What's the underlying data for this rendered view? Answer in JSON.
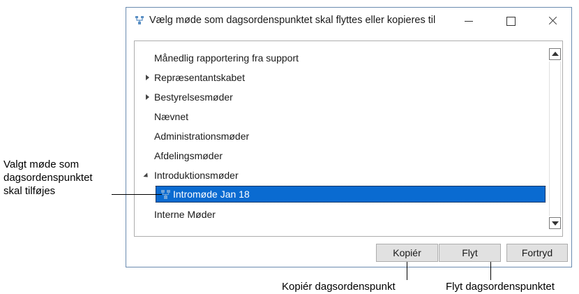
{
  "window": {
    "title": "Vælg møde som dagsordenspunktet skal flyttes eller kopieres til",
    "icon": "meeting-tree-icon"
  },
  "tree": {
    "items": [
      {
        "label": "Månedlig rapportering fra support",
        "expander": "none"
      },
      {
        "label": "Repræsentantskabet",
        "expander": "collapsed"
      },
      {
        "label": "Bestyrelsesmøder",
        "expander": "collapsed"
      },
      {
        "label": "Nævnet",
        "expander": "none"
      },
      {
        "label": "Administrationsmøder",
        "expander": "none"
      },
      {
        "label": "Afdelingsmøder",
        "expander": "none"
      },
      {
        "label": "Introduktionsmøder",
        "expander": "expanded"
      },
      {
        "label": "Interne Møder",
        "expander": "none"
      }
    ],
    "selected": {
      "label": "Intromøde Jan 18",
      "icon": "meeting-icon"
    },
    "selection_color": "#0a6bd1"
  },
  "buttons": {
    "copy": "Kopiér",
    "move": "Flyt",
    "cancel": "Fortryd"
  },
  "annotations": {
    "selected_meeting": [
      "Valgt møde som",
      "dagsordenspunktet",
      "skal tilføjes"
    ],
    "copy": "Kopiér dagsordenspunkt",
    "move": "Flyt dagsordenspunktet"
  }
}
